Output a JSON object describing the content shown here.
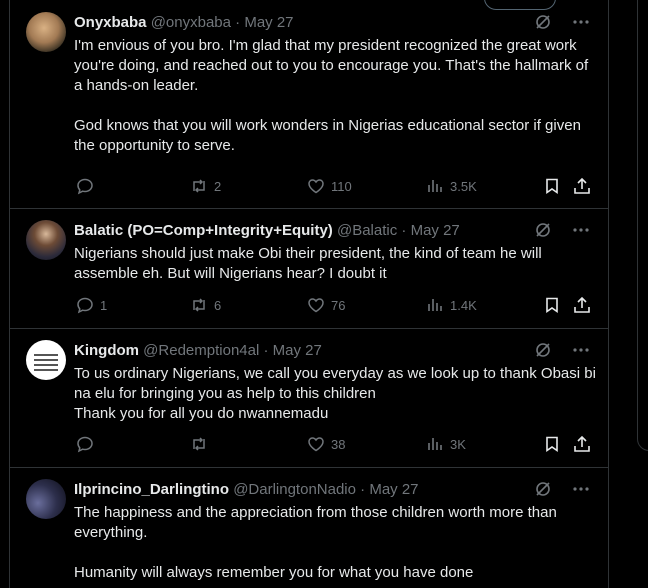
{
  "posts": [
    {
      "name": "Onyxbaba",
      "handle": "@onyxbaba",
      "separator": "·",
      "time": "May 27",
      "paragraphs": [
        "I'm envious of you bro. I'm glad that my president recognized the great work you're doing, and reached out to you to encourage you. That's the hallmark of a hands-on leader.",
        "God knows that you will work wonders in Nigerias educational sector if given the opportunity to serve."
      ],
      "replies": "",
      "reposts": "2",
      "likes": "110",
      "views": "3.5K"
    },
    {
      "name": "Balatic (PO=Comp+Integrity+Equity)",
      "handle": "@Balatic",
      "separator": "·",
      "time": "May 27",
      "paragraphs": [
        "Nigerians should just make Obi their president, the kind of team he will assemble eh. But will Nigerians hear? I doubt it"
      ],
      "replies": "1",
      "reposts": "6",
      "likes": "76",
      "views": "1.4K"
    },
    {
      "name": "Kingdom",
      "handle": "@Redemption4al",
      "separator": "·",
      "time": "May 27",
      "paragraphs": [
        "To us ordinary Nigerians, we call you everyday as we look up to thank Obasi bi na elu for bringing you as help to this children\nThank you for all you do nwannemadu"
      ],
      "replies": "",
      "reposts": "",
      "likes": "38",
      "views": "3K"
    },
    {
      "name": "Ilprincino_Darlingtino",
      "handle": "@DarlingtonNadio",
      "separator": "·",
      "time": "May 27",
      "paragraphs": [
        "The happiness and the appreciation from those children worth more than everything.",
        "Humanity will always remember you for what you have done"
      ]
    }
  ]
}
